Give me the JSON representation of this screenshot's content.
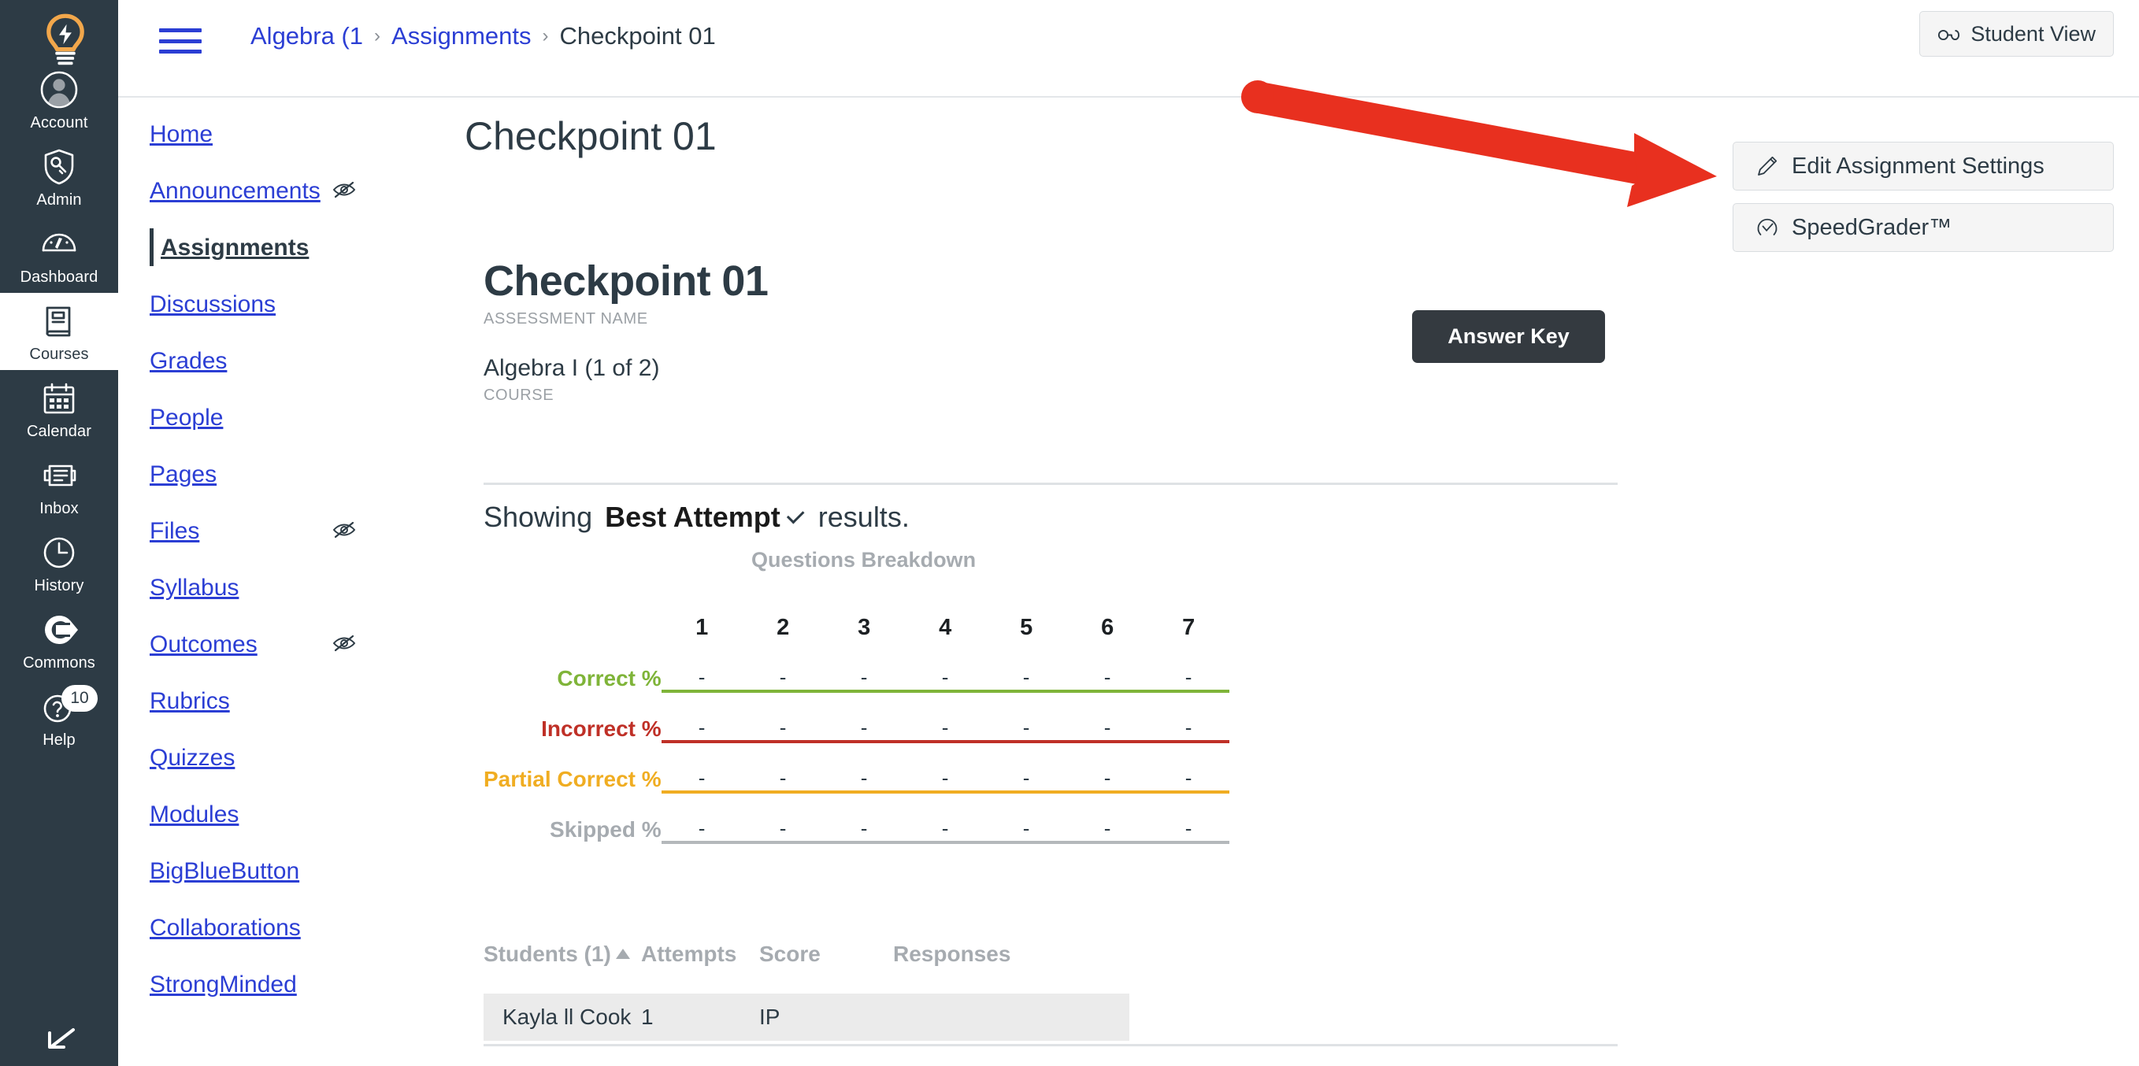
{
  "global_nav": {
    "logo_name": "canvas-lightbulb-logo",
    "items": [
      {
        "label": "Account",
        "icon": "user-avatar-icon",
        "active": false
      },
      {
        "label": "Admin",
        "icon": "shield-key-icon",
        "active": false
      },
      {
        "label": "Dashboard",
        "icon": "gauge-icon",
        "active": false
      },
      {
        "label": "Courses",
        "icon": "book-icon",
        "active": true
      },
      {
        "label": "Calendar",
        "icon": "calendar-icon",
        "active": false
      },
      {
        "label": "Inbox",
        "icon": "inbox-tray-icon",
        "active": false
      },
      {
        "label": "History",
        "icon": "clock-icon",
        "active": false
      },
      {
        "label": "Commons",
        "icon": "commons-arrow-icon",
        "active": false
      },
      {
        "label": "Help",
        "icon": "question-circle-icon",
        "active": false,
        "badge": "10"
      }
    ],
    "collapse_icon": "collapse-arrow-icon"
  },
  "topbar": {
    "menu_icon": "hamburger-menu-icon",
    "breadcrumb": [
      {
        "label": "Algebra (1",
        "link": true
      },
      {
        "label": "Assignments",
        "link": true
      },
      {
        "label": "Checkpoint 01",
        "link": false
      }
    ],
    "separator": "›",
    "student_view_label": "Student View",
    "student_view_icon": "eyeglasses-icon"
  },
  "course_nav": {
    "items": [
      {
        "label": "Home",
        "active": false,
        "hidden_icon": false
      },
      {
        "label": "Announcements",
        "active": false,
        "hidden_icon": true
      },
      {
        "label": "Assignments",
        "active": true,
        "hidden_icon": false
      },
      {
        "label": "Discussions",
        "active": false,
        "hidden_icon": false
      },
      {
        "label": "Grades",
        "active": false,
        "hidden_icon": false
      },
      {
        "label": "People",
        "active": false,
        "hidden_icon": false
      },
      {
        "label": "Pages",
        "active": false,
        "hidden_icon": false
      },
      {
        "label": "Files",
        "active": false,
        "hidden_icon": true
      },
      {
        "label": "Syllabus",
        "active": false,
        "hidden_icon": false
      },
      {
        "label": "Outcomes",
        "active": false,
        "hidden_icon": true
      },
      {
        "label": "Rubrics",
        "active": false,
        "hidden_icon": false
      },
      {
        "label": "Quizzes",
        "active": false,
        "hidden_icon": false
      },
      {
        "label": "Modules",
        "active": false,
        "hidden_icon": false
      },
      {
        "label": "BigBlueButton",
        "active": false,
        "hidden_icon": false
      },
      {
        "label": "Collaborations",
        "active": false,
        "hidden_icon": false
      },
      {
        "label": "StrongMinded",
        "active": false,
        "hidden_icon": false
      }
    ],
    "hidden_icon_name": "eye-slash-icon"
  },
  "main": {
    "page_title": "Checkpoint 01",
    "assessment": {
      "name": "Checkpoint 01",
      "name_label": "ASSESSMENT NAME",
      "course": "Algebra I (1 of 2)",
      "course_label": "COURSE"
    },
    "answer_key_label": "Answer Key",
    "showing": {
      "prefix": "Showing",
      "selected_attempt": "Best Attempt",
      "suffix": "results.",
      "caret_icon": "chevron-down-icon"
    }
  },
  "chart_data": {
    "type": "table",
    "title": "Questions Breakdown",
    "categories": [
      "1",
      "2",
      "3",
      "4",
      "5",
      "6",
      "7"
    ],
    "series": [
      {
        "name": "Correct %",
        "color": "#7fb439",
        "values": [
          "-",
          "-",
          "-",
          "-",
          "-",
          "-",
          "-"
        ]
      },
      {
        "name": "Incorrect %",
        "color": "#bf3027",
        "values": [
          "-",
          "-",
          "-",
          "-",
          "-",
          "-",
          "-"
        ]
      },
      {
        "name": "Partial Correct %",
        "color": "#f0ad22",
        "values": [
          "-",
          "-",
          "-",
          "-",
          "-",
          "-",
          "-"
        ]
      },
      {
        "name": "Skipped %",
        "color": "#a6abb0",
        "values": [
          "-",
          "-",
          "-",
          "-",
          "-",
          "-",
          "-"
        ]
      }
    ],
    "xlabel": "",
    "ylabel": "",
    "legend": "row-labels-left",
    "grid": false
  },
  "students_table": {
    "columns": [
      "Students (1)",
      "Attempts",
      "Score",
      "Responses"
    ],
    "sort_icon": "sort-ascending-icon",
    "rows": [
      {
        "name": "Kayla ll Cook",
        "attempts": "1",
        "score": "IP",
        "responses": ""
      }
    ]
  },
  "right_actions": [
    {
      "label": "Edit Assignment Settings",
      "icon": "pencil-icon"
    },
    {
      "label": "SpeedGrader™",
      "icon": "speedgrader-gauge-icon"
    }
  ],
  "annotation": {
    "type": "arrow",
    "color": "#e8301f",
    "points_to": "Edit Assignment Settings"
  },
  "colors": {
    "global_nav_bg": "#2d3b45",
    "link_blue": "#2b3ed4",
    "correct_green": "#7fb439",
    "incorrect_red": "#bf3027",
    "partial_yellow": "#f0ad22",
    "skipped_gray": "#a6abb0",
    "annotation_red": "#e8301f",
    "answer_key_bg": "#343a40"
  }
}
